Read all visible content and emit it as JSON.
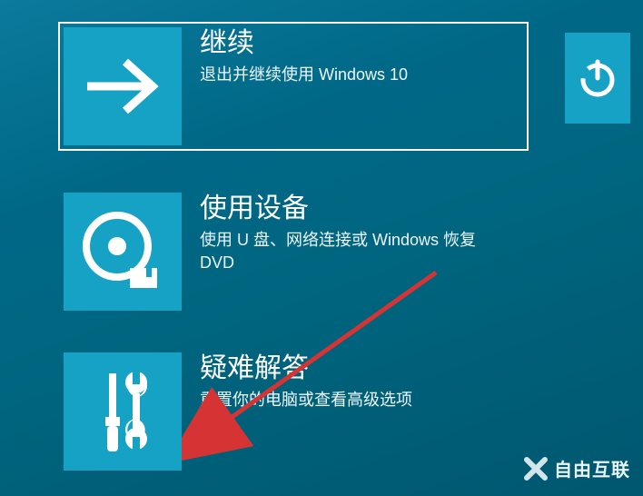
{
  "options": [
    {
      "title": "继续",
      "desc": "退出并继续使用 Windows 10",
      "icon": "arrow-right"
    },
    {
      "title": "使用设备",
      "desc": "使用 U 盘、网络连接或 Windows 恢复 DVD",
      "icon": "disc"
    },
    {
      "title": "疑难解答",
      "desc": "重置你的电脑或查看高级选项",
      "icon": "tools"
    }
  ],
  "watermark": "自由互联",
  "colors": {
    "tile": "#16a2c4",
    "bg_top": "#0b7a9c",
    "bg_bottom": "#00576f",
    "annotation_arrow": "#d63434"
  }
}
